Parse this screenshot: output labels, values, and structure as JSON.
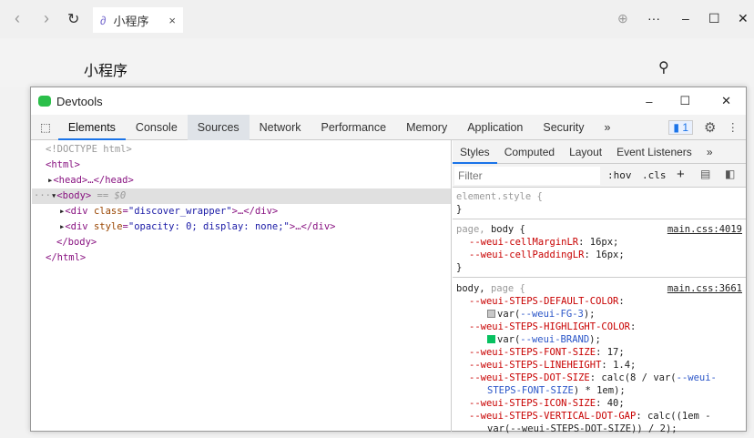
{
  "browser": {
    "tab_title": "小程序",
    "page_title": "小程序"
  },
  "devtools": {
    "title": "Devtools",
    "tabs": [
      "Elements",
      "Console",
      "Sources",
      "Network",
      "Performance",
      "Memory",
      "Application",
      "Security"
    ],
    "more": "»",
    "issues_count": "1",
    "dom": {
      "doctype": "<!DOCTYPE html>",
      "html_open": "<html>",
      "head": "<head>…</head>",
      "body_open": "<body>",
      "body_marker": " == $0",
      "div1_tag": "<div ",
      "div1_attr": "class",
      "div1_val": "\"discover_wrapper\"",
      "div1_end": ">…</div>",
      "div2_tag": "<div ",
      "div2_attr": "style",
      "div2_val": "\"opacity: 0; display: none;\"",
      "div2_end": ">…</div>",
      "body_close": "</body>",
      "html_close": "</html>"
    },
    "styles": {
      "tabs": [
        "Styles",
        "Computed",
        "Layout",
        "Event Listeners"
      ],
      "more": "»",
      "filter_placeholder": "Filter",
      "hov": ":hov",
      "cls": ".cls",
      "plus": "+",
      "element_style": "element.style {",
      "close": "}",
      "rule1": {
        "selector1": "page, ",
        "selector2": "body {",
        "source": "main.css:4019",
        "props": [
          {
            "name": "--weui-cellMarginLR",
            "value": "16px;"
          },
          {
            "name": "--weui-cellPaddingLR",
            "value": "16px;"
          }
        ]
      },
      "rule2": {
        "selector1": "body, ",
        "selector2": "page {",
        "source": "main.css:3661",
        "p1": "--weui-STEPS-DEFAULT-COLOR",
        "p1v_a": "var(",
        "p1v_b": "--weui-FG-3",
        "p1v_c": ");",
        "p1color": "#c8c8c8",
        "p2": "--weui-STEPS-HIGHLIGHT-COLOR",
        "p2v_a": "var(",
        "p2v_b": "--weui-BRAND",
        "p2v_c": ");",
        "p2color": "#07c160",
        "p3": "--weui-STEPS-FONT-SIZE",
        "p3v": "17;",
        "p4": "--weui-STEPS-LINEHEIGHT",
        "p4v": "1.4;",
        "p5": "--weui-STEPS-DOT-SIZE",
        "p5v_a": "calc(8 / var(",
        "p5v_b": "--weui-",
        "p5v_c": "STEPS-FONT-SIZE",
        "p5v_d": ") * 1em);",
        "p6": "--weui-STEPS-ICON-SIZE",
        "p6v": "40;",
        "p7": "--weui-STEPS-VERTICAL-DOT-GAP",
        "p7v": "calc((1em -",
        "p7v_b": "var(--weui-STEPS-DOT-SIZE)) / 2);"
      }
    }
  }
}
